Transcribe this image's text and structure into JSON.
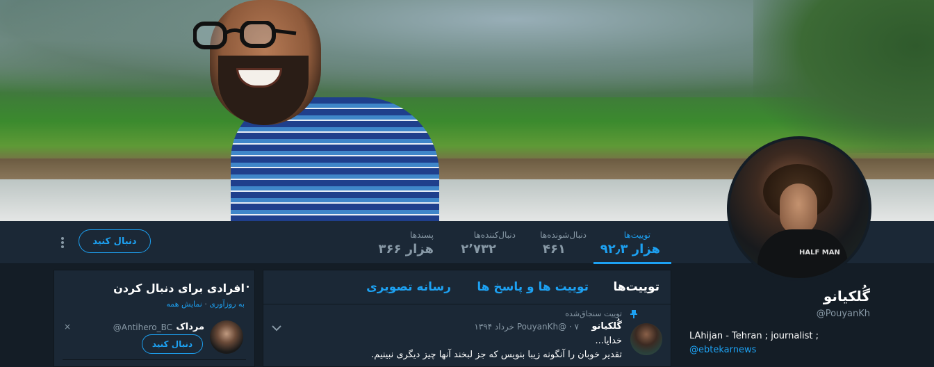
{
  "colors": {
    "accent": "#1da1f2",
    "background": "#141d26",
    "panel": "#1b2836",
    "muted": "#8899a6"
  },
  "nav": {
    "stats": [
      {
        "label": "توییت‌ها",
        "value": "۹۲٫۳ هزار"
      },
      {
        "label": "دنبال‌شونده‌ها",
        "value": "۴۶۱"
      },
      {
        "label": "دنبال‌کننده‌ها",
        "value": "۲٬۷۳۲"
      },
      {
        "label": "پسندها",
        "value": "۳۶۶ هزار"
      }
    ],
    "follow_label": "دنبال کنید",
    "more_icon": "vertical-dots-icon"
  },
  "avatar_shirt_text": "HALF MAN",
  "profile": {
    "name": "گُلکیانو",
    "handle": "@PouyanKh",
    "bio": "LAhijan - Tehran ; journalist ;",
    "link": "@ebtekarnews"
  },
  "timeline": {
    "tabs": [
      "توییت‌ها",
      "توییت ها و پاسخ ها",
      "رسانه تصویری"
    ],
    "pinned_label": "توییت سنجاق‌شده",
    "pin_icon": "pin-icon",
    "tweet": {
      "name": "گُلکیانو",
      "meta": "PouyanKh@ · ۷ خرداد ۱۳۹۴",
      "line1": "خدایا...",
      "line2": "تقدیر خوبان را آنگونه زیبا بنویس که جز لبخند آنها چیز دیگری نبینیم.",
      "caret_icon": "chevron-down-icon"
    }
  },
  "who_to_follow": {
    "title": "افرادی برای دنبال کردن",
    "refresh": "به روزآوری",
    "separator": "·",
    "show_all": "نمایش همه",
    "user": {
      "name": "مرداک",
      "handle": "@Antihero_BC",
      "follow_label": "دنبال کنید",
      "dismiss": "×"
    }
  }
}
